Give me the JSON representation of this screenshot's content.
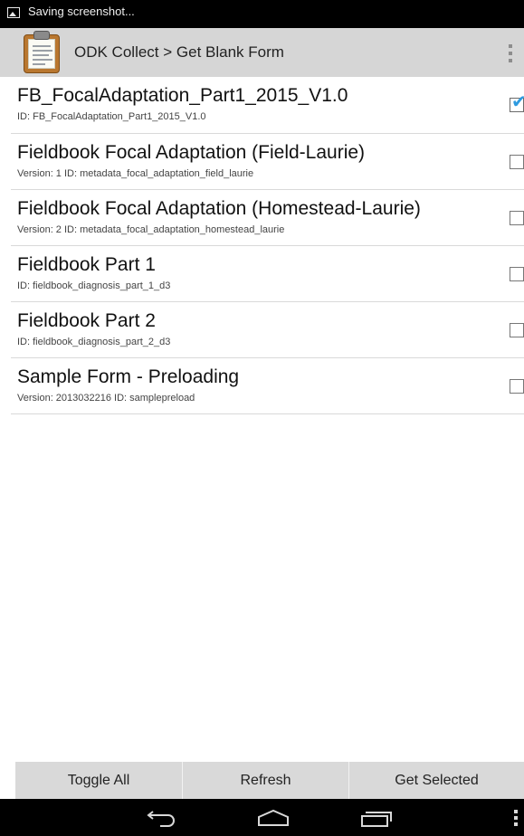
{
  "status_bar": {
    "icon": "screenshot-icon",
    "text": "Saving screenshot..."
  },
  "action_bar": {
    "app_icon": "clipboard-icon",
    "title": "ODK Collect > Get Blank Form",
    "menu_icon": "overflow-menu-icon"
  },
  "forms": [
    {
      "name": "FB_FocalAdaptation_Part1_2015_V1.0",
      "meta": "ID: FB_FocalAdaptation_Part1_2015_V1.0",
      "checked": true
    },
    {
      "name": "Fieldbook Focal Adaptation (Field-Laurie)",
      "meta": "Version: 1 ID: metadata_focal_adaptation_field_laurie",
      "checked": false
    },
    {
      "name": "Fieldbook Focal Adaptation (Homestead-Laurie)",
      "meta": "Version: 2 ID: metadata_focal_adaptation_homestead_laurie",
      "checked": false
    },
    {
      "name": "Fieldbook Part 1",
      "meta": "ID: fieldbook_diagnosis_part_1_d3",
      "checked": false
    },
    {
      "name": "Fieldbook Part 2",
      "meta": "ID: fieldbook_diagnosis_part_2_d3",
      "checked": false
    },
    {
      "name": "Sample Form - Preloading",
      "meta": "Version: 2013032216 ID: samplepreload",
      "checked": false
    }
  ],
  "buttons": {
    "toggle_all": "Toggle All",
    "refresh": "Refresh",
    "get_selected": "Get Selected"
  },
  "nav_bar": {
    "back_icon": "back-icon",
    "home_icon": "home-icon",
    "recents_icon": "recent-apps-icon",
    "menu_icon": "menu-icon"
  },
  "colors": {
    "action_bar_bg": "#d6d6d6",
    "button_bg": "#d9d9d9",
    "check_color": "#2f9be0",
    "divider": "#d9d9d9"
  }
}
